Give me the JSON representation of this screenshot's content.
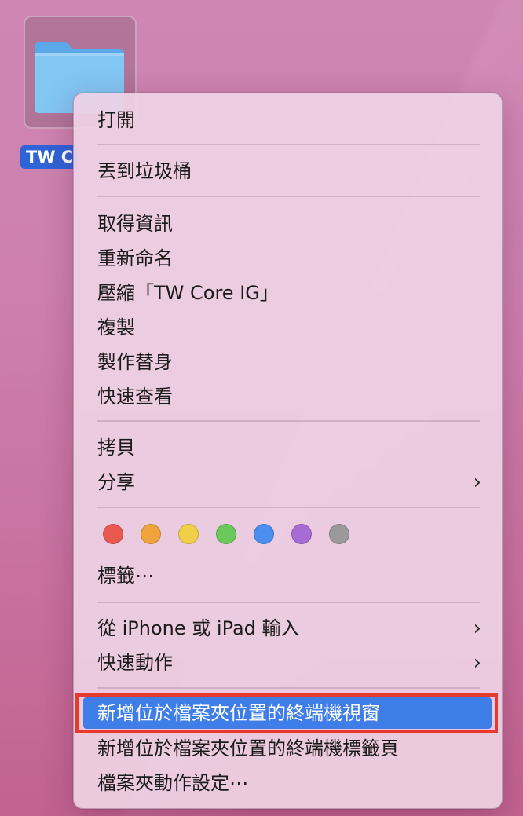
{
  "desktop": {
    "folder_label": "TW C",
    "colors": {
      "folder": "#7cc1f2",
      "selection_label": "#2f63d8"
    }
  },
  "menu": {
    "open": "打開",
    "trash": "丟到垃圾桶",
    "get_info": "取得資訊",
    "rename": "重新命名",
    "compress": "壓縮「TW Core IG」",
    "duplicate": "複製",
    "make_alias": "製作替身",
    "quick_look": "快速查看",
    "copy": "拷貝",
    "share": "分享",
    "tags": "標籤⋯",
    "import_from_iphone": "從 iPhone 或 iPad 輸入",
    "quick_actions": "快速動作",
    "new_terminal_window": "新增位於檔案夾位置的終端機視窗",
    "new_terminal_tab": "新增位於檔案夾位置的終端機標籤頁",
    "folder_actions_setup": "檔案夾動作設定⋯",
    "chevron": "›",
    "tag_colors": [
      "#e85a4f",
      "#f0a23c",
      "#f2cf48",
      "#6bc85a",
      "#4b8ef0",
      "#a66cd4",
      "#9a9a9c"
    ],
    "highlight_color": "#3f7ee8",
    "annotation_color": "#e8392d"
  }
}
